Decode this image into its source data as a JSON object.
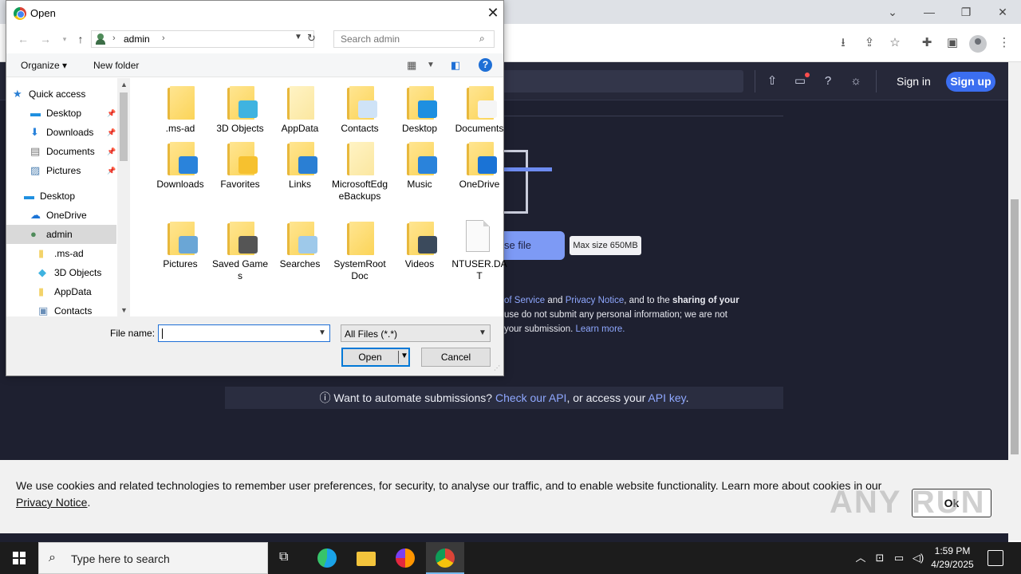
{
  "browser": {
    "window_controls": {
      "minimize": "—",
      "restore": "❐",
      "close": "✕",
      "tab_menu": "⌄"
    },
    "toolbar_icons": [
      "download-icon",
      "share-icon",
      "star-icon",
      "extensions-icon",
      "sidepanel-icon",
      "profile-icon",
      "menu-icon"
    ]
  },
  "site": {
    "header": {
      "signin": "Sign in",
      "signup": "Sign up"
    },
    "choose_file_label": "se file",
    "max_size": "Max size 650MB",
    "tos": {
      "l1_link1": "of Service",
      "l1_and": " and ",
      "l1_link2": "Privacy Notice",
      "l1_rest": ", and to the ",
      "l1_bold": "sharing of your",
      "l2": "use do not submit any personal information; we are not",
      "l3": "your submission.",
      "l3_link": "Learn more."
    },
    "automate": {
      "icon": "ⓘ",
      "text": "Want to automate submissions?",
      "link1": "Check our API",
      "mid": ", or access your",
      "link2": "API key",
      "end": "."
    },
    "cookie": {
      "text": "We use cookies and related technologies to remember user preferences, for security, to analyse our traffic, and to enable website functionality. Learn more about cookies in our ",
      "link": "Privacy Notice",
      "end": ".",
      "ok": "Ok"
    },
    "watermark": "ANY RUN"
  },
  "dialog": {
    "title": "Open",
    "close": "✕",
    "address": {
      "location": "admin",
      "chevron": "›"
    },
    "search_placeholder": "Search admin",
    "commands": {
      "organize": "Organize ▾",
      "new_folder": "New folder",
      "help": "?"
    },
    "nav_items": [
      {
        "label": "Quick access",
        "icon": "star-icon"
      },
      {
        "label": "Desktop",
        "icon": "desktop-icon"
      },
      {
        "label": "Downloads",
        "icon": "download-icon"
      },
      {
        "label": "Documents",
        "icon": "documents-icon"
      },
      {
        "label": "Pictures",
        "icon": "pictures-icon"
      },
      {
        "label": "Desktop",
        "icon": "desktop-icon"
      },
      {
        "label": "OneDrive",
        "icon": "cloud-icon"
      },
      {
        "label": "admin",
        "icon": "user-icon"
      },
      {
        "label": ".ms-ad",
        "icon": "folder-icon"
      },
      {
        "label": "3D Objects",
        "icon": "cube-icon"
      },
      {
        "label": "AppData",
        "icon": "folder-icon"
      },
      {
        "label": "Contacts",
        "icon": "contacts-icon"
      }
    ],
    "files": [
      {
        "label": ".ms-ad",
        "kind": "folder"
      },
      {
        "label": "3D Objects",
        "kind": "folder",
        "badge": "#3fb3e0"
      },
      {
        "label": "AppData",
        "kind": "folder-light"
      },
      {
        "label": "Contacts",
        "kind": "folder",
        "badge": "#cfe3f7"
      },
      {
        "label": "Desktop",
        "kind": "folder",
        "badge": "#1e8fe0"
      },
      {
        "label": "Documents",
        "kind": "folder",
        "badge": "#f5f5f5"
      },
      {
        "label": "Downloads",
        "kind": "folder",
        "badge": "#2a83db"
      },
      {
        "label": "Favorites",
        "kind": "folder",
        "badge": "#f6c12f"
      },
      {
        "label": "Links",
        "kind": "folder",
        "badge": "#2a7fd4"
      },
      {
        "label": "MicrosoftEdgeBackups",
        "kind": "folder-light"
      },
      {
        "label": "Music",
        "kind": "folder",
        "badge": "#2a83db"
      },
      {
        "label": "OneDrive",
        "kind": "folder",
        "badge": "#1a73d6"
      },
      {
        "label": "Pictures",
        "kind": "folder",
        "badge": "#6aa6d6"
      },
      {
        "label": "Saved Games",
        "kind": "folder",
        "badge": "#555555"
      },
      {
        "label": "Searches",
        "kind": "folder",
        "badge": "#9ec9ea"
      },
      {
        "label": "SystemRootDoc",
        "kind": "folder"
      },
      {
        "label": "Videos",
        "kind": "folder",
        "badge": "#3b4a5c"
      },
      {
        "label": "NTUSER.DAT",
        "kind": "file"
      }
    ],
    "filename_label": "File name:",
    "filename_value": "",
    "filetype": "All Files (*.*)",
    "open": "Open",
    "cancel": "Cancel"
  },
  "taskbar": {
    "search_placeholder": "Type here to search",
    "time": "1:59 PM",
    "date": "4/29/2025",
    "apps": [
      "task-view-icon",
      "edge-icon",
      "file-explorer-icon",
      "firefox-icon",
      "chrome-icon"
    ]
  },
  "colors": {
    "accent": "#3b6ef0",
    "dialog_accent": "#0078d7",
    "site_bg": "#1e2030"
  }
}
